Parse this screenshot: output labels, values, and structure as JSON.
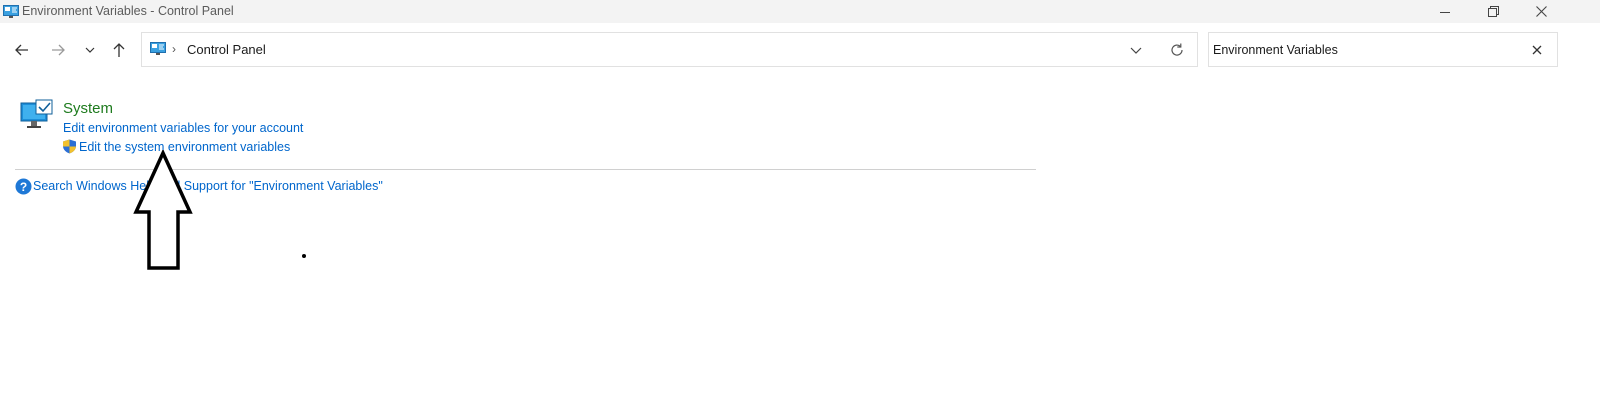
{
  "window": {
    "title": "Environment Variables - Control Panel",
    "buttons": [
      "minimize",
      "restore",
      "close"
    ]
  },
  "nav": {
    "icons": [
      "back-arrow-icon",
      "forward-arrow-icon",
      "recent-locations-icon",
      "up-arrow-icon"
    ]
  },
  "address_bar": {
    "breadcrumb_separator": "›",
    "location": "Control Panel"
  },
  "search": {
    "value": "Environment Variables"
  },
  "results": {
    "category_title": "System",
    "links": [
      "Edit environment variables for your account",
      "Edit the system environment variables"
    ],
    "help_link": "Search Windows Help and Support for \"Environment Variables\""
  },
  "colors": {
    "category_title": "#1e7b1e",
    "link": "#0066cc",
    "titlebar_bg": "#f3f3f3"
  }
}
